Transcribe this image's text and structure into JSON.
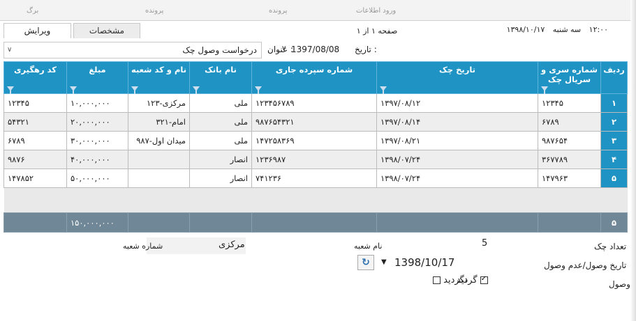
{
  "topbar": {
    "items": [
      "برگ",
      "پرونده",
      "پرونده",
      "ورود اطلاعات"
    ]
  },
  "tabs": [
    {
      "label": "ویرایش",
      "active": true
    },
    {
      "label": "مشخصات",
      "active": false
    }
  ],
  "paging": {
    "text": "صفحه ۱ از ۱"
  },
  "datetime": {
    "time": "۱۲:۰۰",
    "day": "سه شنبه",
    "date": "۱۳۹۸/۱۰/۱۷"
  },
  "filter": {
    "date_label": "تاریخ :",
    "date_value": "1397/08/08",
    "title_label": "عنوان :",
    "title_value": "درخواست وصول چک"
  },
  "table": {
    "columns": [
      "ردیف",
      "شماره سری و سریال چک",
      "تاریخ چک",
      "شماره سپرده جاری",
      "نام بانک",
      "نام و کد شعبه",
      "مبلغ",
      "کد رهگیری"
    ],
    "rows": [
      {
        "row": "۱",
        "serial": "۱۲۳۴۵",
        "date": "۱۳۹۷/۰۸/۱۲",
        "account": "۱۲۳۴۵۶۷۸۹",
        "bank": "ملی",
        "branch": "مرکزی-۱۲۳",
        "amount": "۱۰,۰۰۰,۰۰۰",
        "tracking": "۱۲۳۴۵"
      },
      {
        "row": "۲",
        "serial": "۶۷۸۹",
        "date": "۱۳۹۷/۰۸/۱۴",
        "account": "۹۸۷۶۵۴۳۲۱",
        "bank": "ملی",
        "branch": "امام-۳۲۱",
        "amount": "۲۰,۰۰۰,۰۰۰",
        "tracking": "۵۴۳۲۱"
      },
      {
        "row": "۳",
        "serial": "۹۸۷۶۵۴",
        "date": "۱۳۹۷/۰۸/۲۱",
        "account": "۱۴۷۲۵۸۳۶۹",
        "bank": "ملی",
        "branch": "میدان اول-۹۸۷",
        "amount": "۳۰,۰۰۰,۰۰۰",
        "tracking": "۶۷۸۹"
      },
      {
        "row": "۴",
        "serial": "۳۶۷۷۸۹",
        "date": "۱۳۹۸/۰۷/۲۴",
        "account": "۱۲۳۶۹۸۷",
        "bank": "انصار",
        "branch": "",
        "amount": "۴۰,۰۰۰,۰۰۰",
        "tracking": "۹۸۷۶"
      },
      {
        "row": "۵",
        "serial": "۱۴۷۹۶۳",
        "date": "۱۳۹۸/۰۷/۲۴",
        "account": "۷۴۱۲۳۶",
        "bank": "انصار",
        "branch": "",
        "amount": "۵۰,۰۰۰,۰۰۰",
        "tracking": "۱۴۷۸۵۲"
      }
    ],
    "total_count": "۵",
    "total_amount": "۱۵۰,۰۰۰,۰۰۰"
  },
  "details": {
    "count_label": "تعداد چک",
    "count_value": "5",
    "branch_name_label": "نام شعبه",
    "branch_name_value": "مرکزی",
    "branch_no_label": "شماره شعبه",
    "receipt_date_label": "تاریخ وصول/عدم وصول",
    "receipt_date_value": "1398/10/17",
    "receipt_label": "وصول",
    "passed_label": "گردید",
    "passed_checked": true,
    "not_passed_label": "نگردید",
    "not_passed_checked": false
  }
}
